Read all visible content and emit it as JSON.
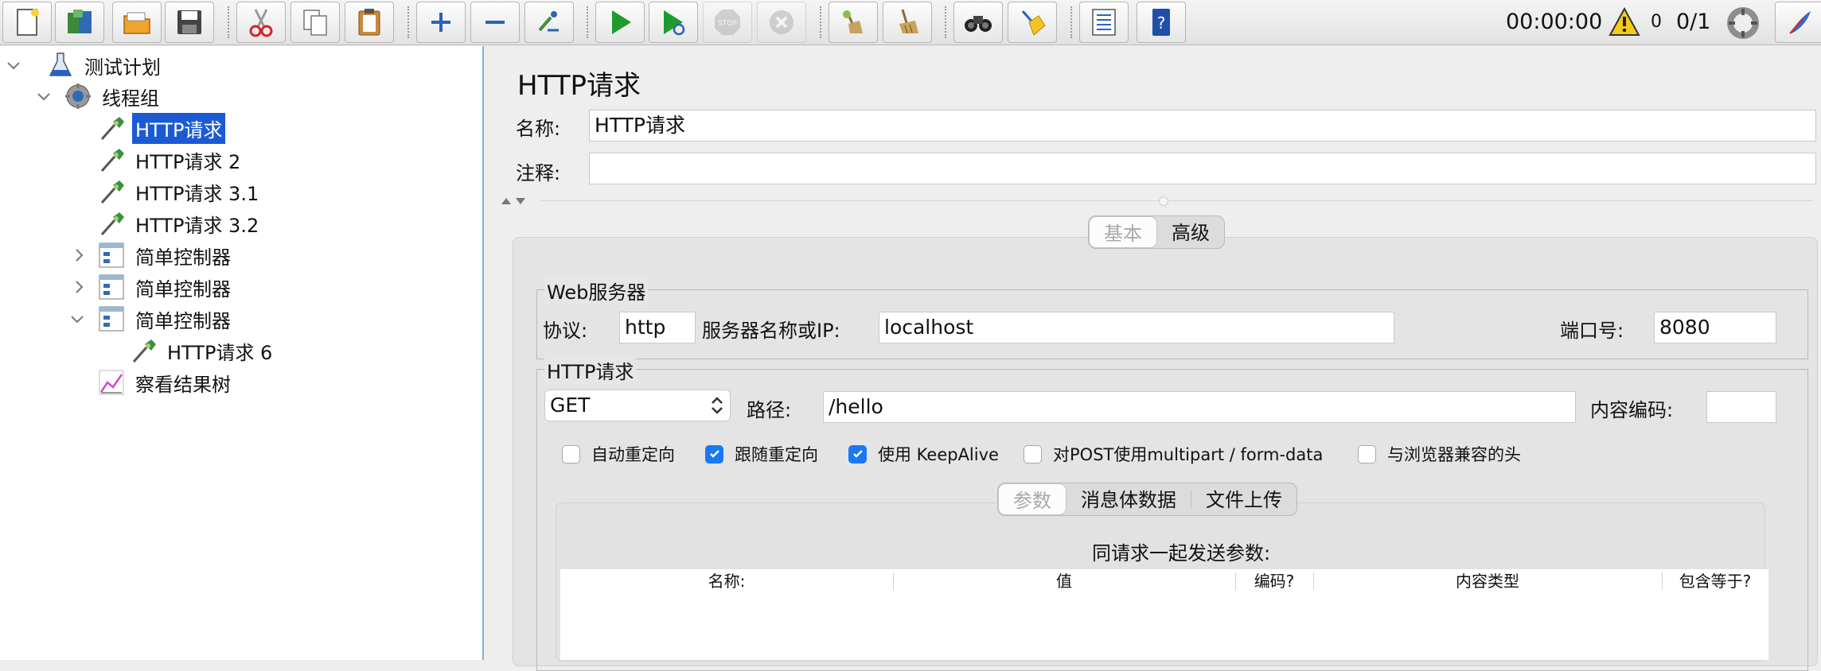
{
  "toolbar": {
    "buttons": [
      {
        "icon": "new-icon",
        "enabled": true
      },
      {
        "icon": "templates-icon",
        "enabled": true
      },
      {
        "icon": "open-icon",
        "enabled": true
      },
      {
        "icon": "save-icon",
        "enabled": true
      },
      {
        "icon": "cut-icon",
        "enabled": true
      },
      {
        "icon": "copy-icon",
        "enabled": true
      },
      {
        "icon": "paste-icon",
        "enabled": true
      },
      {
        "icon": "expand-icon",
        "enabled": true
      },
      {
        "icon": "collapse-icon",
        "enabled": true
      },
      {
        "icon": "toggle-icon",
        "enabled": true
      },
      {
        "icon": "start-icon",
        "enabled": true
      },
      {
        "icon": "start-no-pauses-icon",
        "enabled": true
      },
      {
        "icon": "stop-icon",
        "enabled": false
      },
      {
        "icon": "shutdown-icon",
        "enabled": false
      },
      {
        "icon": "clear-icon",
        "enabled": true
      },
      {
        "icon": "clear-all-icon",
        "enabled": true
      },
      {
        "icon": "search-icon",
        "enabled": true
      },
      {
        "icon": "reset-search-icon",
        "enabled": true
      },
      {
        "icon": "function-helper-icon",
        "enabled": true
      },
      {
        "icon": "help-icon",
        "enabled": true
      }
    ],
    "timer": "00:00:00",
    "warning_count": "0",
    "threads": "0/1"
  },
  "tree": {
    "nodes": [
      {
        "label": "测试计划",
        "icon": "test-plan-icon",
        "expander": "expanded"
      },
      {
        "label": "线程组",
        "icon": "thread-group-icon",
        "expander": "expanded"
      },
      {
        "label": "HTTP请求",
        "icon": "http-sampler-icon",
        "selected": true
      },
      {
        "label": "HTTP请求 2",
        "icon": "http-sampler-icon"
      },
      {
        "label": "HTTP请求 3.1",
        "icon": "http-sampler-icon"
      },
      {
        "label": "HTTP请求 3.2",
        "icon": "http-sampler-icon"
      },
      {
        "label": "简单控制器",
        "icon": "simple-controller-icon",
        "expander": "collapsed"
      },
      {
        "label": "简单控制器",
        "icon": "simple-controller-icon",
        "expander": "collapsed"
      },
      {
        "label": "简单控制器",
        "icon": "simple-controller-icon",
        "expander": "expanded"
      },
      {
        "label": "HTTP请求 6",
        "icon": "http-sampler-icon"
      },
      {
        "label": "察看结果树",
        "icon": "results-tree-icon"
      }
    ]
  },
  "panel": {
    "title": "HTTP请求",
    "name_label": "名称:",
    "name_value": "HTTP请求",
    "comment_label": "注释:",
    "comment_value": "",
    "tabs": [
      "基本",
      "高级"
    ],
    "web_server": {
      "legend": "Web服务器",
      "protocol_label": "协议:",
      "protocol_value": "http",
      "server_label": "服务器名称或IP:",
      "server_value": "localhost",
      "port_label": "端口号:",
      "port_value": "8080"
    },
    "http_request": {
      "legend": "HTTP请求",
      "method": "GET",
      "path_label": "路径:",
      "path_value": "/hello",
      "encoding_label": "内容编码:",
      "encoding_value": "",
      "checkboxes": [
        {
          "label": "自动重定向",
          "checked": false
        },
        {
          "label": "跟随重定向",
          "checked": true
        },
        {
          "label": "使用 KeepAlive",
          "checked": true
        },
        {
          "label": "对POST使用multipart / form-data",
          "checked": false
        },
        {
          "label": "与浏览器兼容的头",
          "checked": false
        }
      ],
      "subtabs": [
        "参数",
        "消息体数据",
        "文件上传"
      ],
      "params_caption": "同请求一起发送参数:",
      "columns": [
        "名称:",
        "值",
        "编码?",
        "内容类型",
        "包含等于?"
      ]
    }
  }
}
